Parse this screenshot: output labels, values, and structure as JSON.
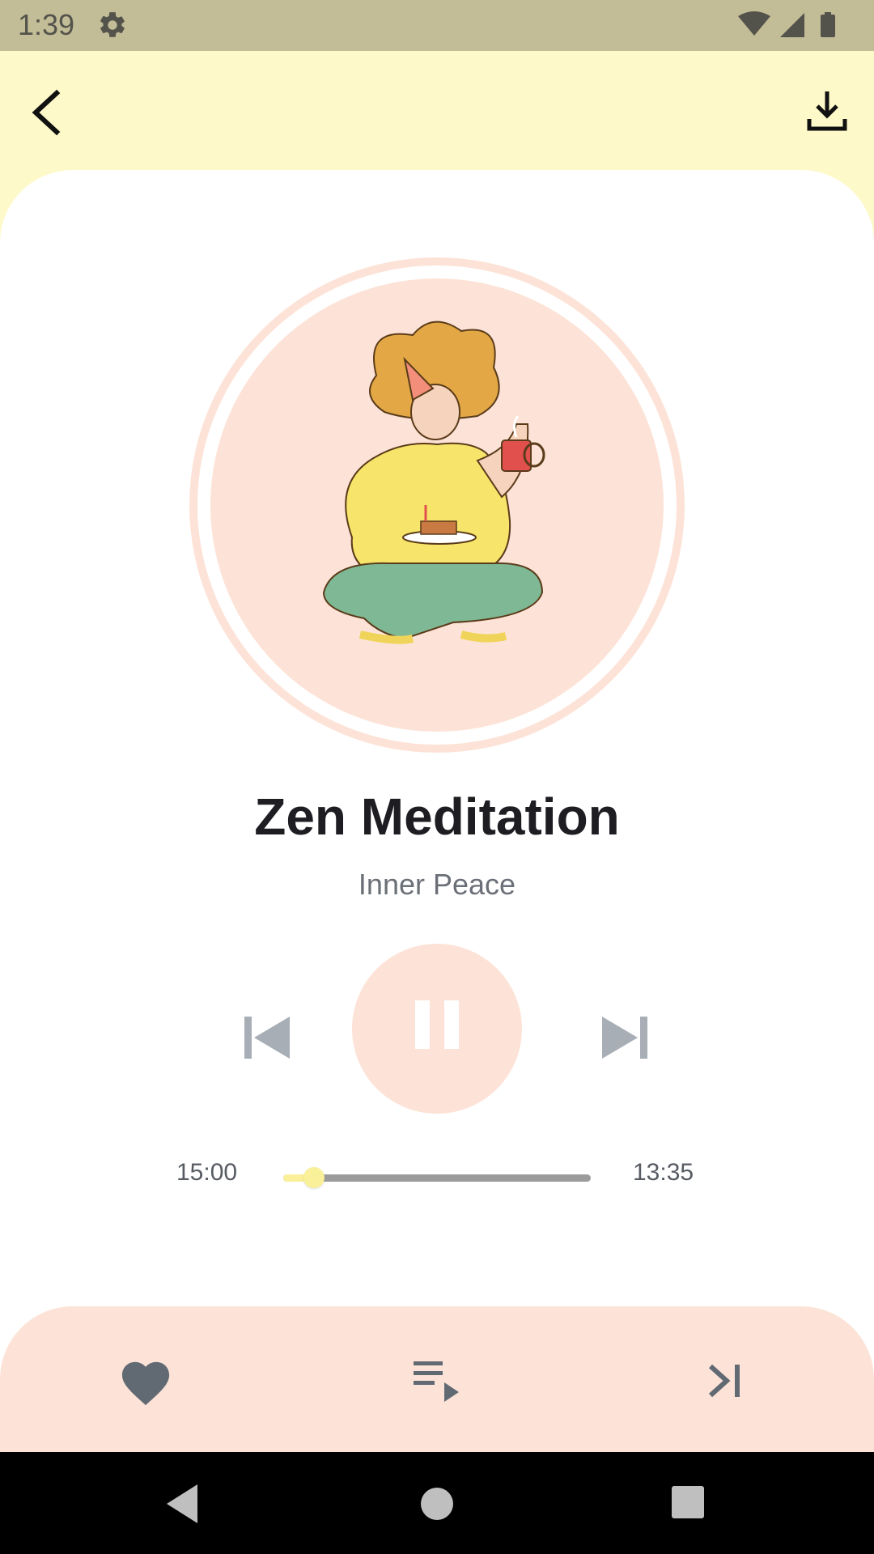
{
  "status_bar": {
    "time": "1:39",
    "icons": [
      "settings-icon",
      "wifi-icon",
      "cellular-icon",
      "battery-icon"
    ]
  },
  "top_bar": {
    "back_icon": "chevron-left-icon",
    "download_icon": "download-icon"
  },
  "player": {
    "title": "Zen Meditation",
    "subtitle": "Inner Peace",
    "controls": [
      "skip-previous-icon",
      "pause-icon",
      "skip-next-icon"
    ],
    "elapsed_label": "15:00",
    "remaining_label": "13:35",
    "progress_fraction": 0.1
  },
  "bottom_actions": {
    "icons": [
      "heart-icon",
      "playlist-play-icon",
      "skip-to-end-icon"
    ]
  },
  "nav_bar": {
    "icons": [
      "nav-back-icon",
      "nav-home-icon",
      "nav-recents-icon"
    ]
  },
  "colors": {
    "background_yellow": "#FEF9C8",
    "status_bar": "#C2BC97",
    "accent_peach": "#FDE3D7",
    "slider_yellow": "#FBF09A",
    "icon_gray": "#616A73"
  }
}
